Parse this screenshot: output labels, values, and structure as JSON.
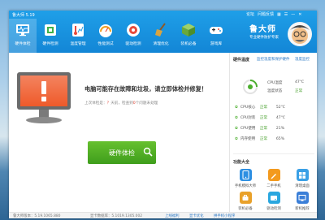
{
  "title": "鲁大师 5.19",
  "window_controls": {
    "feedback": "论坛",
    "login": "问题反馈",
    "minimize": "—",
    "close": "✕"
  },
  "nav": [
    {
      "label": "硬件体检",
      "icon": "health-check-icon",
      "active": true
    },
    {
      "label": "硬件检测",
      "icon": "hardware-detect-icon"
    },
    {
      "label": "温度管理",
      "icon": "thermometer-icon"
    },
    {
      "label": "性能测试",
      "icon": "speedometer-icon"
    },
    {
      "label": "驱动检测",
      "icon": "driver-icon"
    },
    {
      "label": "清理优化",
      "icon": "broom-icon"
    },
    {
      "label": "装机必备",
      "icon": "apps-icon"
    },
    {
      "label": "游戏库",
      "icon": "gamepad-icon"
    }
  ],
  "brand": {
    "name": "鲁大师",
    "slogan": "专业硬件防护专家"
  },
  "main": {
    "message": "电脑可能存在故障和垃圾，请立即体检并修复！",
    "sub_prefix": "上次体检是：",
    "sub_days": "？",
    "sub_mid": "天前，检查到",
    "sub_count": "0",
    "sub_suffix": "个问题未处理",
    "button": "硬件体检"
  },
  "sidebar": {
    "temp_header": "硬件温度",
    "temp_link1": "监控温度和保护硬件",
    "temp_link2": "温度监控",
    "temps": [
      {
        "label": "CPU温度",
        "value": "47℃"
      },
      {
        "label": "温度状态",
        "value": "正常"
      }
    ],
    "stats": [
      {
        "label": "CPU核心",
        "value": "52℃",
        "status": "正常"
      },
      {
        "label": "CPU封装",
        "value": "47℃",
        "status": "正常"
      },
      {
        "label": "CPU使用",
        "value": "21%",
        "status": "正常"
      },
      {
        "label": "内存使用",
        "value": "65%",
        "status": "正常"
      }
    ],
    "tools_header": "功能大全",
    "tools": [
      {
        "label": "手机模拟大师",
        "color": "#2d8fe2",
        "icon": "phone-icon"
      },
      {
        "label": "二手手机",
        "color": "#f39a1e",
        "icon": "pen-icon"
      },
      {
        "label": "清理桌面",
        "color": "#3aa0e6",
        "icon": "grid-icon"
      },
      {
        "label": "装机必备",
        "color": "#e9a12a",
        "icon": "tools-icon"
      },
      {
        "label": "驱动检测",
        "color": "#2aa7df",
        "icon": "drive-icon"
      },
      {
        "label": "新机推荐",
        "color": "#3b7fd8",
        "icon": "monitor-icon"
      }
    ]
  },
  "status": {
    "version": "鲁大师版本：5.19.1065.880",
    "lib": "显卡数据库：5.1019.1305.002",
    "link1": "上线福利",
    "link2": "显卡优化",
    "link3": "拼手机小程序"
  }
}
